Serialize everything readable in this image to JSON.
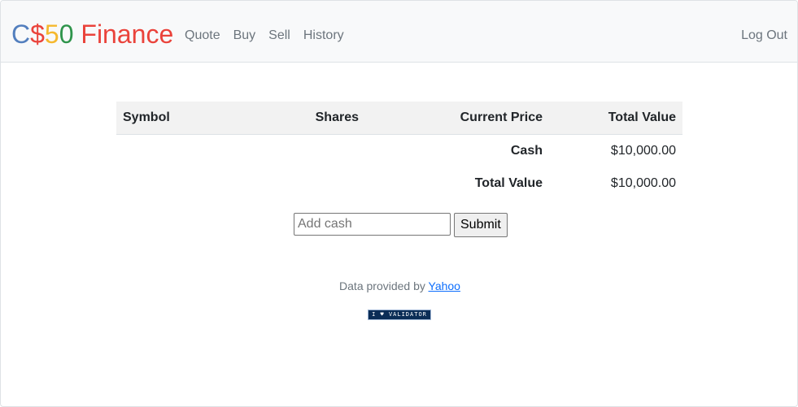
{
  "brand": {
    "part1": "C",
    "part2": "$",
    "part3": "5",
    "part4": "0",
    "part5": " Finance"
  },
  "nav": {
    "items": [
      {
        "label": "Quote"
      },
      {
        "label": "Buy"
      },
      {
        "label": "Sell"
      },
      {
        "label": "History"
      }
    ],
    "logout_label": "Log Out"
  },
  "table": {
    "headers": [
      "Symbol",
      "Shares",
      "Current Price",
      "Total Value"
    ],
    "summary": [
      {
        "label": "Cash",
        "value": "$10,000.00"
      },
      {
        "label": "Total Value",
        "value": "$10,000.00"
      }
    ]
  },
  "cash_form": {
    "placeholder": "Add cash",
    "value": "",
    "submit_label": "Submit"
  },
  "footer": {
    "text": "Data provided by ",
    "link_label": "Yahoo",
    "badge_text": "I ♥ VALIDATOR"
  },
  "colors": {
    "brand_blue": "#537fbe",
    "brand_red": "#ea433b",
    "brand_yellow": "#f5b82e",
    "brand_green": "#2e944b",
    "navbar_bg": "#f8f9fa",
    "link": "#0d6efd"
  }
}
